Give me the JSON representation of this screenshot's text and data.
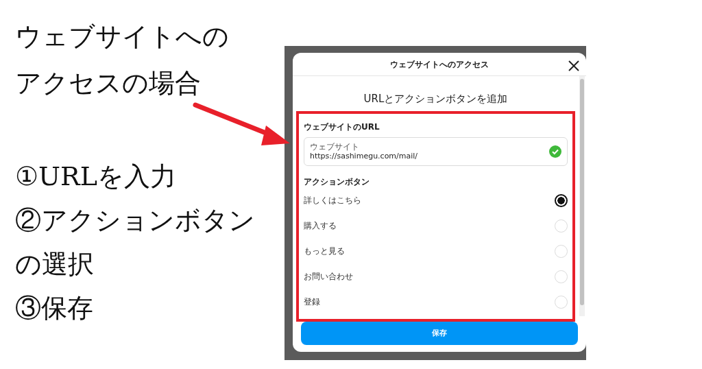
{
  "annotation": {
    "heading": [
      "ウェブサイトへの",
      "アクセスの場合"
    ],
    "steps": [
      "①URLを入力",
      "②アクションボタン",
      "の選択",
      "③保存"
    ]
  },
  "dialog": {
    "title": "ウェブサイトへのアクセス",
    "subtitle": "URLとアクションボタンを追加",
    "url_section": {
      "heading": "ウェブサイトのURL",
      "field": {
        "label": "ウェブサイト",
        "value": "https://sashimegu.com/mail/",
        "valid": true
      }
    },
    "action_section": {
      "heading": "アクションボタン",
      "options": [
        {
          "label": "詳しくはこちら",
          "selected": true
        },
        {
          "label": "購入する",
          "selected": false
        },
        {
          "label": "もっと見る",
          "selected": false
        },
        {
          "label": "お問い合わせ",
          "selected": false
        },
        {
          "label": "登録",
          "selected": false
        }
      ]
    },
    "save_button": "保存"
  }
}
